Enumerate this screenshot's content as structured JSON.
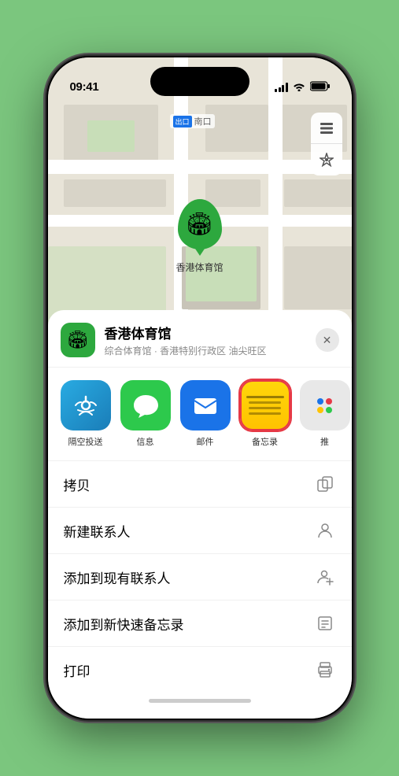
{
  "status_bar": {
    "time": "09:41",
    "signal_bars": [
      4,
      6,
      8,
      10
    ],
    "wifi_icon": "wifi",
    "battery_icon": "battery"
  },
  "map": {
    "label_text": "南口",
    "layer_icon": "🗺",
    "location_icon": "➤"
  },
  "venue_pin": {
    "icon": "🏟",
    "label": "香港体育馆"
  },
  "bottom_sheet": {
    "venue": {
      "icon": "🏟",
      "name": "香港体育馆",
      "subtitle": "综合体育馆 · 香港特别行政区 油尖旺区"
    },
    "close_label": "✕",
    "share_apps": [
      {
        "id": "airdrop",
        "label": "隔空投送",
        "type": "airdrop"
      },
      {
        "id": "messages",
        "label": "信息",
        "type": "messages"
      },
      {
        "id": "mail",
        "label": "邮件",
        "type": "mail"
      },
      {
        "id": "notes",
        "label": "备忘录",
        "type": "notes"
      },
      {
        "id": "more",
        "label": "推",
        "type": "more"
      }
    ],
    "actions": [
      {
        "label": "拷贝",
        "icon": "copy"
      },
      {
        "label": "新建联系人",
        "icon": "person"
      },
      {
        "label": "添加到现有联系人",
        "icon": "person-add"
      },
      {
        "label": "添加到新快速备忘录",
        "icon": "note"
      },
      {
        "label": "打印",
        "icon": "print"
      }
    ]
  }
}
